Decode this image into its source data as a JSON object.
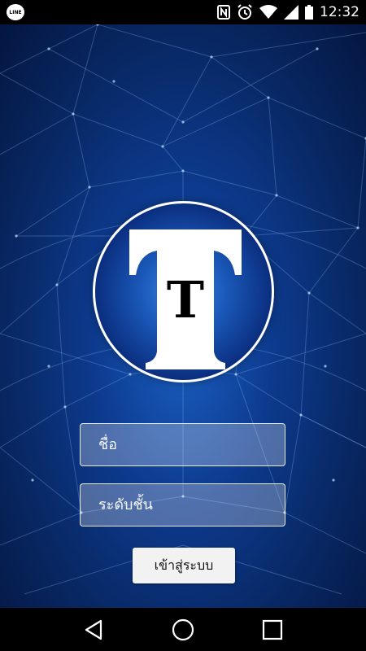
{
  "status_bar": {
    "app_icon": "line-icon",
    "app_icon_text": "LINE",
    "icons": [
      "nfc-icon",
      "alarm-icon",
      "wifi-icon",
      "signal-icon",
      "battery-icon"
    ],
    "time": "12:32"
  },
  "logo": {
    "big_letter": "T",
    "small_letter": "T"
  },
  "form": {
    "name_placeholder": "ชื่อ",
    "grade_placeholder": "ระดับชั้น",
    "login_label": "เข้าสู่ระบบ"
  },
  "nav_bar": {
    "icons": [
      "back-icon",
      "home-icon",
      "recents-icon"
    ]
  },
  "colors": {
    "background": "#0d3a8e",
    "field_border": "#ffffff",
    "button_bg": "#f2f2f2"
  }
}
